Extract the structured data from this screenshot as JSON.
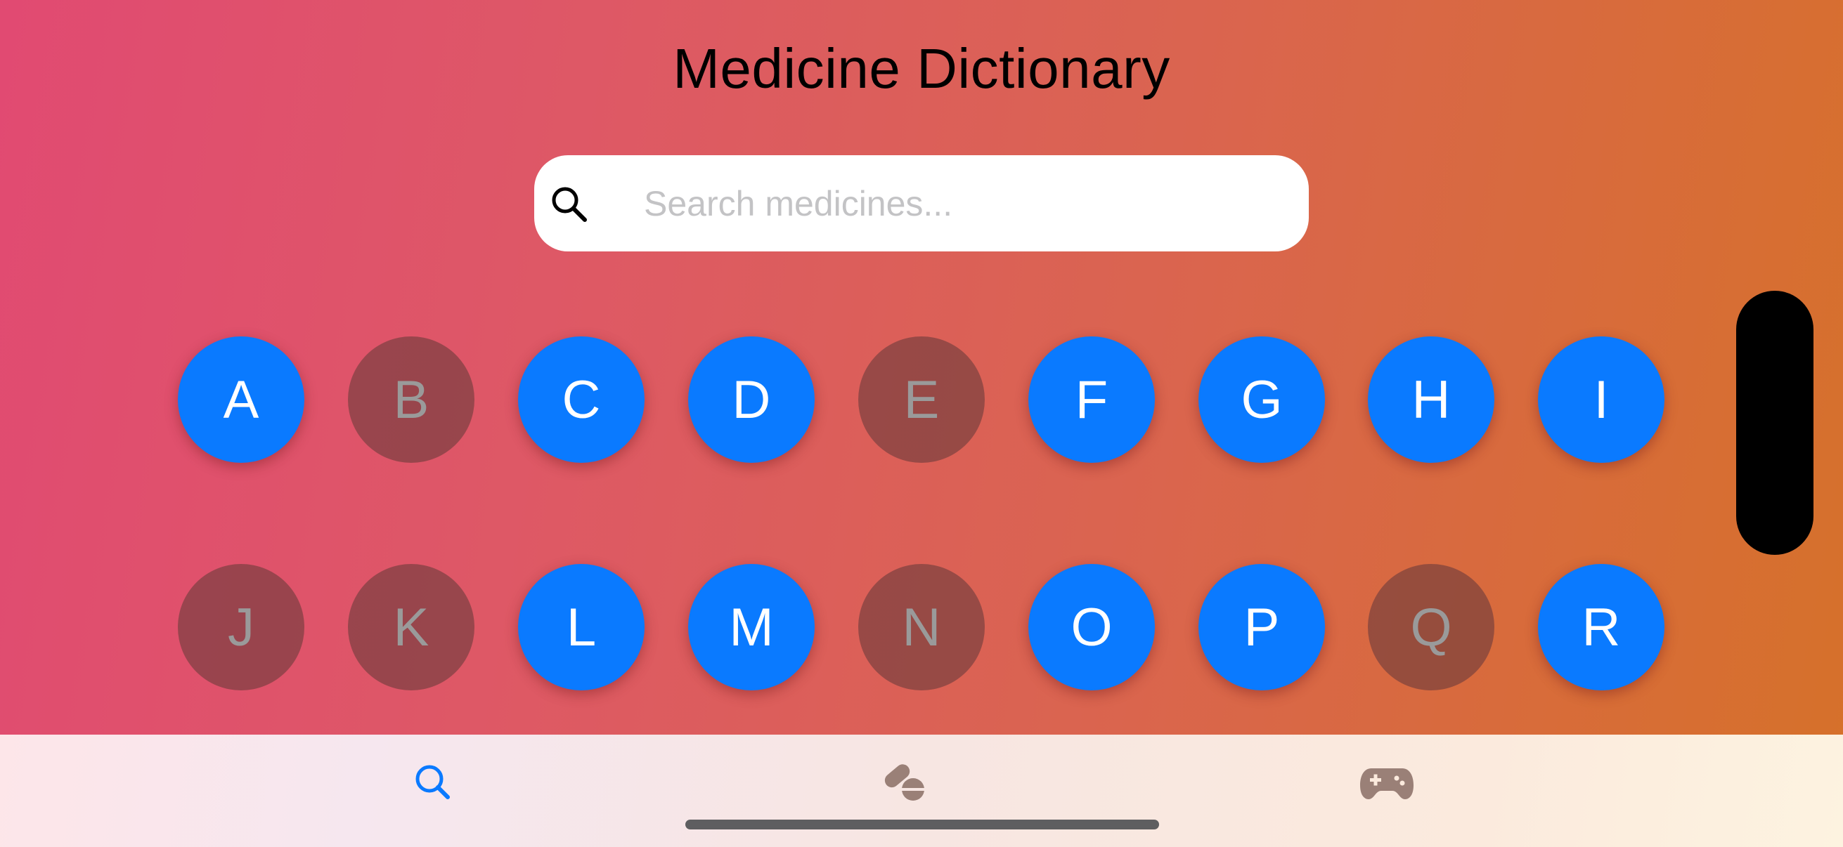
{
  "header": {
    "title": "Medicine Dictionary"
  },
  "search": {
    "placeholder": "Search medicines...",
    "value": "",
    "icon": "search-icon"
  },
  "letters": [
    {
      "label": "A",
      "enabled": true
    },
    {
      "label": "B",
      "enabled": false
    },
    {
      "label": "C",
      "enabled": true
    },
    {
      "label": "D",
      "enabled": true
    },
    {
      "label": "E",
      "enabled": false
    },
    {
      "label": "F",
      "enabled": true
    },
    {
      "label": "G",
      "enabled": true
    },
    {
      "label": "H",
      "enabled": true
    },
    {
      "label": "I",
      "enabled": true
    },
    {
      "label": "J",
      "enabled": false
    },
    {
      "label": "K",
      "enabled": false
    },
    {
      "label": "L",
      "enabled": true
    },
    {
      "label": "M",
      "enabled": true
    },
    {
      "label": "N",
      "enabled": false
    },
    {
      "label": "O",
      "enabled": true
    },
    {
      "label": "P",
      "enabled": true
    },
    {
      "label": "Q",
      "enabled": false
    },
    {
      "label": "R",
      "enabled": true
    }
  ],
  "tabbar": {
    "tabs": [
      {
        "name": "search",
        "icon": "search-icon",
        "selected": true
      },
      {
        "name": "medicines",
        "icon": "pills-icon",
        "selected": false
      },
      {
        "name": "games",
        "icon": "gamecontroller-icon",
        "selected": false
      }
    ]
  },
  "colors": {
    "accent": "#0a7aff",
    "tab_inactive": "#9a8077",
    "letter_disabled_text": "#9a9a9a"
  }
}
